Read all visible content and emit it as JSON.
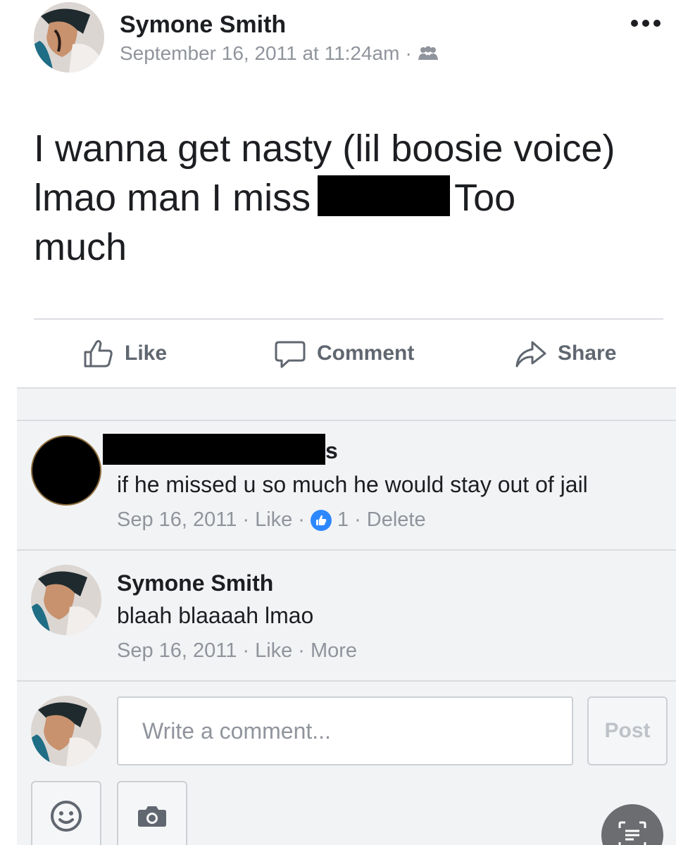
{
  "post": {
    "author": "Symone Smith",
    "timestamp": "September 16, 2011 at 11:24am",
    "separator": "·",
    "privacy_icon": "friends-icon",
    "text_line1": "I wanna get nasty (lil boosie voice)",
    "text_line2_before": "lmao man I miss",
    "text_line2_after": "Too",
    "text_line3": "much"
  },
  "actions": {
    "like": "Like",
    "comment": "Comment",
    "share": "Share"
  },
  "comments": [
    {
      "name_tail": "s",
      "text": "if he missed u so much he would stay out of jail",
      "date": "Sep 16, 2011",
      "like_label": "Like",
      "like_count": "1",
      "delete_label": "Delete"
    },
    {
      "name": "Symone Smith",
      "text": "blaah blaaaah lmao",
      "date": "Sep 16, 2011",
      "like_label": "Like",
      "more_label": "More"
    }
  ],
  "composer": {
    "placeholder": "Write a comment...",
    "post_label": "Post"
  },
  "colors": {
    "accent": "#2d88ff",
    "meta_gray": "#90949c",
    "action_gray": "#606770",
    "comments_bg": "#f2f3f5"
  }
}
